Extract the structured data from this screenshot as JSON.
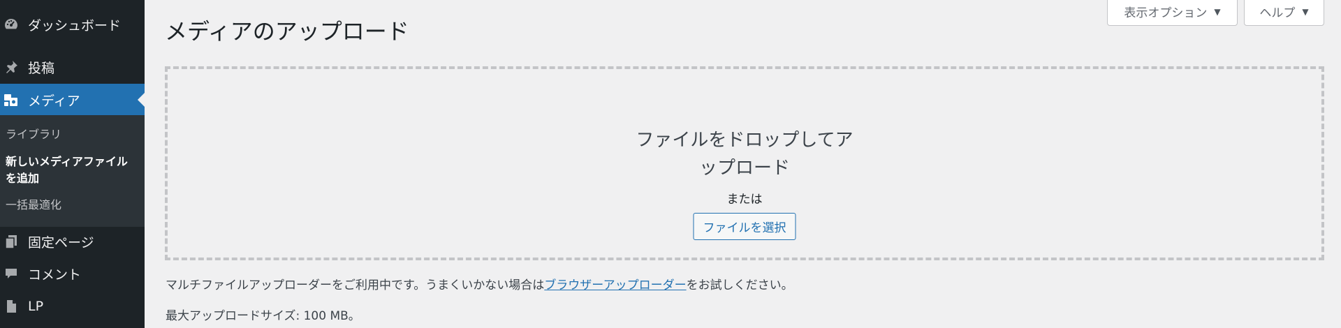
{
  "sidebar": {
    "items": [
      {
        "label": "ダッシュボード",
        "icon": "dashboard-icon"
      },
      {
        "label": "投稿",
        "icon": "pushpin-icon"
      },
      {
        "label": "メディア",
        "icon": "media-icon",
        "active": true
      },
      {
        "label": "固定ページ",
        "icon": "pages-icon"
      },
      {
        "label": "コメント",
        "icon": "comment-icon"
      },
      {
        "label": "LP",
        "icon": "document-icon"
      }
    ],
    "submenu": [
      {
        "label": "ライブラリ"
      },
      {
        "label": "新しいメディアファイルを追加",
        "current": true
      },
      {
        "label": "一括最適化"
      }
    ]
  },
  "header": {
    "title": "メディアのアップロード",
    "screen_options_label": "表示オプション",
    "help_label": "ヘルプ"
  },
  "uploader": {
    "instructions": "ファイルをドロップしてアップロード",
    "or_text": "または",
    "select_button": "ファイルを選択"
  },
  "info": {
    "multi_prefix": "マルチファイルアップローダーをご利用中です。うまくいかない場合は",
    "browser_uploader_link": "ブラウザーアップローダー",
    "multi_suffix": "をお試しください。",
    "max_size": "最大アップロードサイズ: 100 MB。"
  },
  "colors": {
    "sidebar_bg": "#1d2327",
    "submenu_bg": "#2c3338",
    "accent": "#2271b1",
    "page_bg": "#f0f0f1"
  }
}
